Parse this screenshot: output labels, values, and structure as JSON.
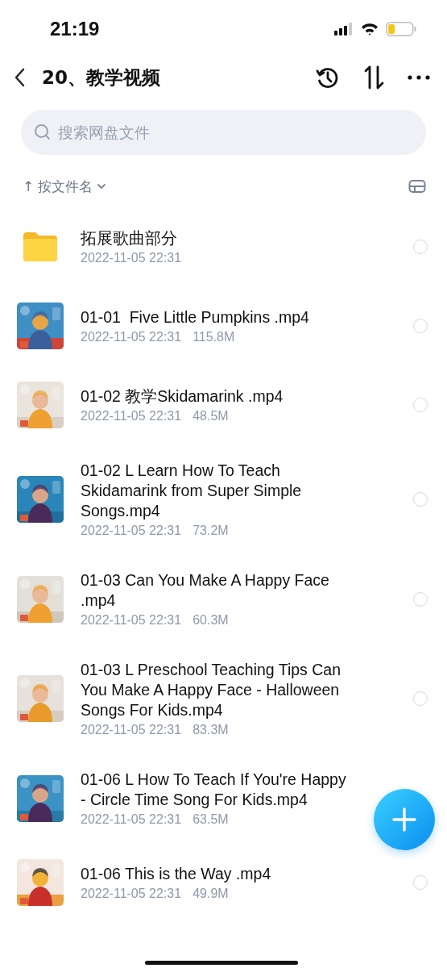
{
  "status_bar": {
    "time": "21:19"
  },
  "nav": {
    "title": "20、教学视频"
  },
  "search": {
    "placeholder": "搜索网盘文件"
  },
  "sort": {
    "arrow": "↑",
    "label": "按文件名"
  },
  "files": [
    {
      "kind": "folder",
      "name": "拓展歌曲部分",
      "date": "2022-11-05 22:31",
      "selected": false
    },
    {
      "kind": "video",
      "name": "01-01  Five Little Pumpkins .mp4",
      "date": "2022-11-05 22:31",
      "size": "115.8M",
      "selected": false
    },
    {
      "kind": "video",
      "name": "01-02 教学Skidamarink .mp4",
      "date": "2022-11-05 22:31",
      "size": "48.5M",
      "selected": false
    },
    {
      "kind": "video",
      "name": "01-02 L Learn How To Teach Skidamarink from Super Simple Songs.mp4",
      "date": "2022-11-05 22:31",
      "size": "73.2M",
      "selected": false
    },
    {
      "kind": "video",
      "name": "01-03 Can You Make A Happy Face .mp4",
      "date": "2022-11-05 22:31",
      "size": "60.3M",
      "selected": false
    },
    {
      "kind": "video",
      "name": "01-03 L Preschool Teaching Tips Can You Make A Happy Face - Halloween Songs For Kids.mp4",
      "date": "2022-11-05 22:31",
      "size": "83.3M",
      "selected": false
    },
    {
      "kind": "video",
      "name": "01-06 L How To Teach If You're Happy - Circle Time Song For Kids.mp4",
      "date": "2022-11-05 22:31",
      "size": "63.5M"
    },
    {
      "kind": "video",
      "name": "01-06 This is the Way .mp4",
      "date": "2022-11-05 22:31",
      "size": "49.9M",
      "selected": false
    }
  ]
}
